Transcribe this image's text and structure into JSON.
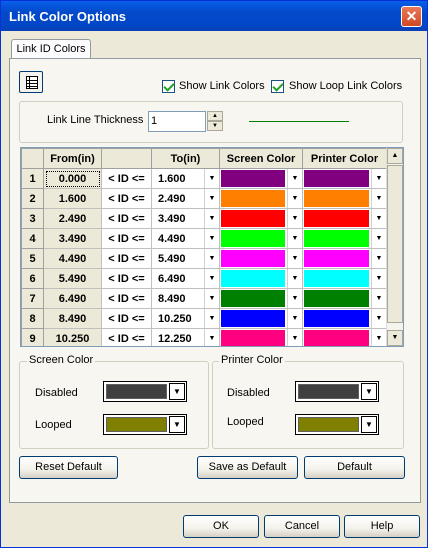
{
  "window": {
    "title": "Link Color Options"
  },
  "tabs": [
    {
      "label": "Link ID Colors"
    }
  ],
  "options": {
    "show_link_colors": {
      "label": "Show Link Colors",
      "checked": true
    },
    "show_loop_link_colors": {
      "label": "Show Loop Link Colors",
      "checked": true
    }
  },
  "thickness": {
    "label": "Link Line Thickness",
    "value": "1",
    "preview_color": "#008000"
  },
  "grid": {
    "headers": {
      "from": "From(in)",
      "to": "To(in)",
      "screen": "Screen Color",
      "printer": "Printer Color"
    },
    "rows": [
      {
        "n": "1",
        "from": "0.000",
        "op": "< ID <=",
        "to": "1.600",
        "screen": "#800080",
        "printer": "#800080"
      },
      {
        "n": "2",
        "from": "1.600",
        "op": "< ID <=",
        "to": "2.490",
        "screen": "#ff8000",
        "printer": "#ff8000"
      },
      {
        "n": "3",
        "from": "2.490",
        "op": "< ID <=",
        "to": "3.490",
        "screen": "#ff0000",
        "printer": "#ff0000"
      },
      {
        "n": "4",
        "from": "3.490",
        "op": "< ID <=",
        "to": "4.490",
        "screen": "#00ff00",
        "printer": "#00ff00"
      },
      {
        "n": "5",
        "from": "4.490",
        "op": "< ID <=",
        "to": "5.490",
        "screen": "#ff00ff",
        "printer": "#ff00ff"
      },
      {
        "n": "6",
        "from": "5.490",
        "op": "< ID <=",
        "to": "6.490",
        "screen": "#00ffff",
        "printer": "#00ffff"
      },
      {
        "n": "7",
        "from": "6.490",
        "op": "< ID <=",
        "to": "8.490",
        "screen": "#008000",
        "printer": "#008000"
      },
      {
        "n": "8",
        "from": "8.490",
        "op": "< ID <=",
        "to": "10.250",
        "screen": "#0000ff",
        "printer": "#0000ff"
      },
      {
        "n": "9",
        "from": "10.250",
        "op": "< ID <=",
        "to": "12.250",
        "screen": "#ff0080",
        "printer": "#ff0080"
      }
    ]
  },
  "screen_color": {
    "title": "Screen Color",
    "disabled_label": "Disabled",
    "disabled_color": "#404040",
    "looped_label": "Looped",
    "looped_color": "#808000"
  },
  "printer_color": {
    "title": "Printer Color",
    "disabled_label": "Disabled",
    "disabled_color": "#404040",
    "looped_label": "Looped",
    "looped_color": "#808000"
  },
  "buttons": {
    "reset_default": "Reset Default",
    "save_as_default": "Save as Default",
    "default": "Default",
    "ok": "OK",
    "cancel": "Cancel",
    "help": "Help"
  }
}
